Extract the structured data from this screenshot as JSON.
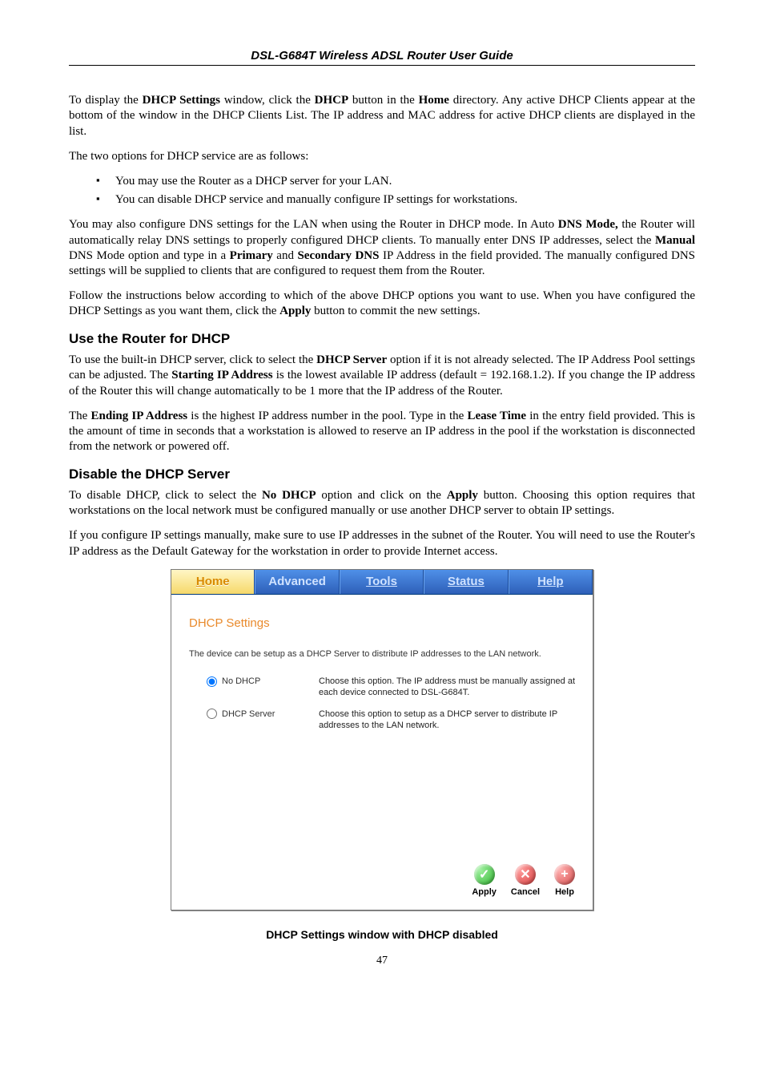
{
  "header": {
    "title": "DSL-G684T Wireless ADSL Router User Guide"
  },
  "p1": {
    "a": "To display the ",
    "b1": "DHCP Settings",
    "b": " window, click the ",
    "b2": "DHCP",
    "c": " button in the ",
    "b3": "Home",
    "d": " directory. Any active DHCP Clients appear at the bottom of the window in the DHCP Clients List. The IP address and MAC address for active DHCP clients are displayed in the list."
  },
  "p2": "The two options for DHCP service are as follows:",
  "bullets": [
    "You may use the Router as a DHCP server for your LAN.",
    "You can disable DHCP service and manually configure IP settings for workstations."
  ],
  "p3": {
    "a": "You may also configure DNS settings for the LAN when using the Router in DHCP mode. In Auto ",
    "b1": "DNS Mode,",
    "b": " the Router will automatically relay DNS settings to properly configured DHCP clients. To manually enter DNS IP addresses, select the ",
    "b2": "Manual",
    "c": " DNS Mode option and type in a ",
    "b3": "Primary",
    "d": " and ",
    "b4": "Secondary DNS",
    "e": " IP Address in the field provided. The manually configured DNS settings will be supplied to clients that are configured to request them from the Router."
  },
  "p4": {
    "a": "Follow the instructions below according to which of the above DHCP options you want to use. When you have configured the DHCP Settings as you want them, click the ",
    "b1": "Apply",
    "b": " button to commit the new settings."
  },
  "h1": "Use the Router for DHCP",
  "p5": {
    "a": "To use the built-in DHCP server, click to select the ",
    "b1": "DHCP Server",
    "b": " option if it is not already selected. The IP Address Pool settings can be adjusted. The ",
    "b2": "Starting IP Address",
    "c": " is the lowest available IP address (default = 192.168.1.2). If you change the IP address of the Router this will change automatically to be 1 more that the IP address of the Router."
  },
  "p6": {
    "a": "The ",
    "b1": "Ending IP Address",
    "b": " is the highest IP address number in the pool. Type in the ",
    "b2": "Lease Time",
    "c": " in the entry field provided. This is the amount of time in seconds that a workstation is allowed to reserve an IP address in the pool if the workstation is disconnected from the network or powered off."
  },
  "h2": "Disable the DHCP Server",
  "p7": {
    "a": "To disable DHCP, click to select the ",
    "b1": "No DHCP",
    "b": " option and click on the ",
    "b2": "Apply",
    "c": " button. Choosing this option requires that workstations on the local network must be configured manually or use another DHCP server to obtain IP settings."
  },
  "p8": "If you configure IP settings manually, make sure to use IP addresses in the subnet of the Router. You will need to use the Router's IP address as the Default Gateway for the workstation in order to provide Internet access.",
  "router": {
    "tabs": {
      "home": "Home",
      "advanced": "Advanced",
      "tools": "Tools",
      "status": "Status",
      "help": "Help"
    },
    "panel_title": "DHCP Settings",
    "panel_desc": "The device can be setup as a DHCP Server to distribute IP addresses to the LAN network.",
    "opt_no_dhcp": {
      "label": "No DHCP",
      "desc": "Choose this option. The IP address must be manually assigned at each device connected to DSL-G684T."
    },
    "opt_dhcp_server": {
      "label": "DHCP Server",
      "desc": "Choose this option to setup as a DHCP server to distribute IP addresses to the LAN network."
    },
    "actions": {
      "apply": "Apply",
      "cancel": "Cancel",
      "help": "Help"
    }
  },
  "caption": "DHCP Settings window with DHCP disabled",
  "page_number": "47"
}
